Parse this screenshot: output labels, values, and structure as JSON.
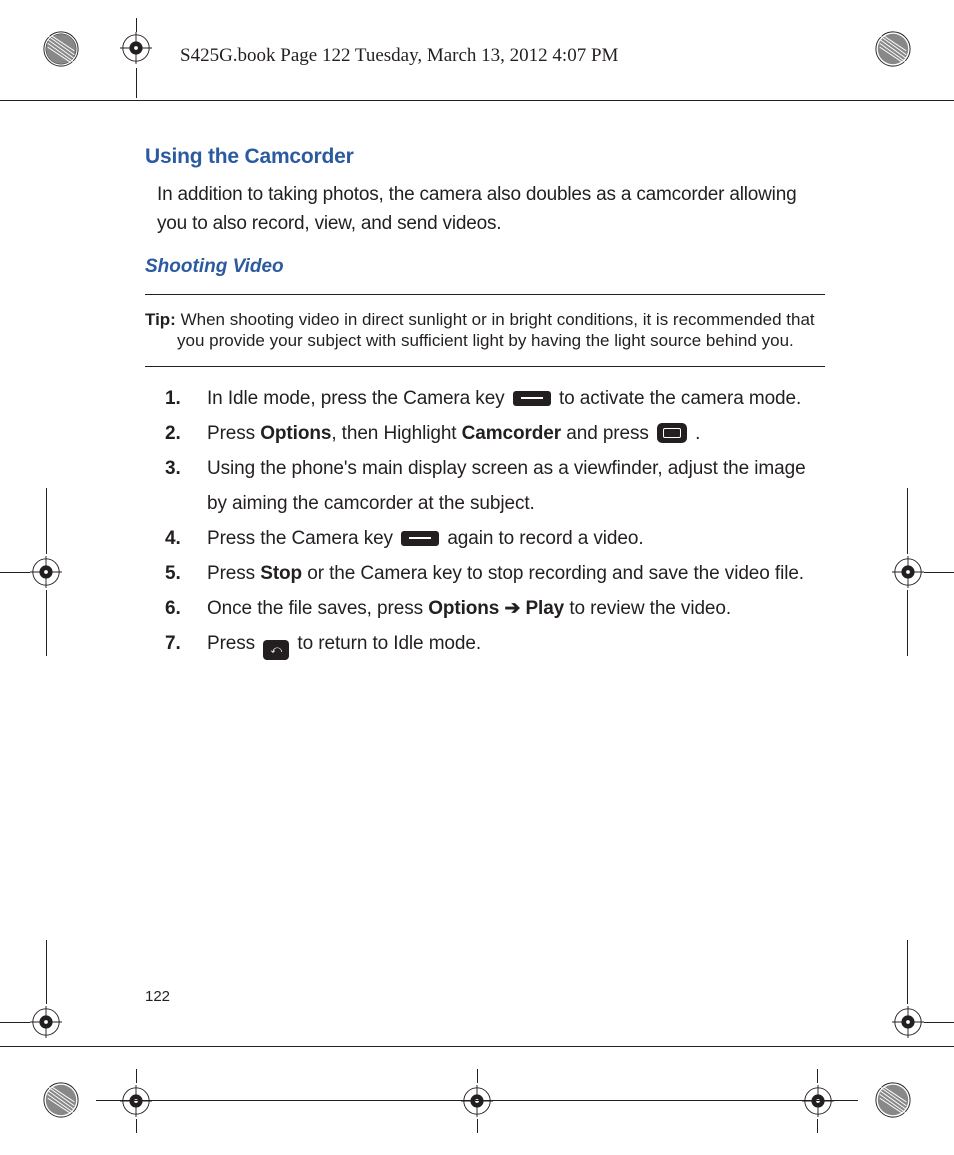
{
  "header": "S425G.book  Page 122  Tuesday, March 13, 2012  4:07 PM",
  "section_title": "Using the Camcorder",
  "intro": "In addition to taking photos, the camera also doubles as a camcorder allowing you to also record, view, and send videos.",
  "sub_title": "Shooting Video",
  "tip": {
    "label": "Tip:",
    "text": "When shooting video in direct sunlight or in bright conditions, it is recommended that you provide your subject with sufficient light by having the light source behind you."
  },
  "steps": [
    {
      "num": "1.",
      "pre": "In Idle mode, press the Camera key ",
      "icon": "camkey",
      "post": " to activate the camera mode."
    },
    {
      "num": "2.",
      "parts": [
        "Press ",
        {
          "b": "Options"
        },
        ", then Highlight ",
        {
          "b": "Camcorder"
        },
        " and press ",
        {
          "icon": "select"
        },
        " ."
      ]
    },
    {
      "num": "3.",
      "text": "Using the phone's main display screen as a viewfinder, adjust the image by aiming the camcorder at the subject."
    },
    {
      "num": "4.",
      "pre": "Press the Camera key ",
      "icon": "camkey",
      "post": " again to record a video."
    },
    {
      "num": "5.",
      "parts": [
        "Press ",
        {
          "b": "Stop"
        },
        " or the Camera key to stop recording and save the video file."
      ]
    },
    {
      "num": "6.",
      "parts": [
        "Once the file saves, press ",
        {
          "b": "Options"
        },
        " ",
        {
          "arrow": "➔"
        },
        " ",
        {
          "b": "Play"
        },
        " to review the video."
      ]
    },
    {
      "num": "7.",
      "pre": "Press ",
      "icon": "end",
      "post": " to return to Idle mode."
    }
  ],
  "page_number": "122"
}
